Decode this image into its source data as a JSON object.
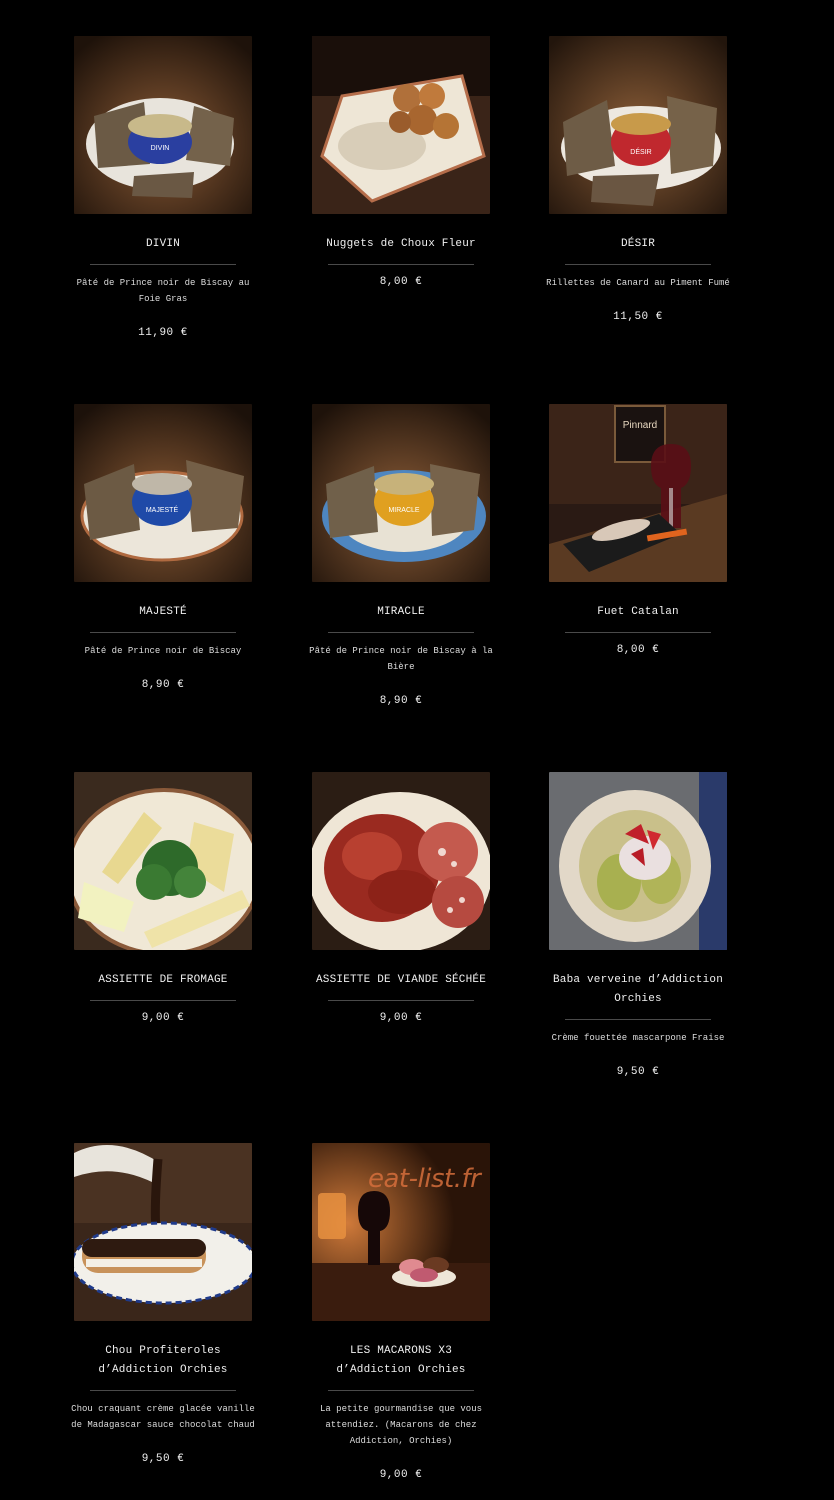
{
  "items": [
    {
      "name": "DIVIN",
      "desc": "Pâté de Prince noir de Biscay au Foie Gras",
      "price": "11,90 €",
      "tin_label": "DIVIN",
      "tin_color": "#2a3fa0"
    },
    {
      "name": "Nuggets de Choux Fleur",
      "desc": "",
      "price": "8,00 €"
    },
    {
      "name": "DÉSIR",
      "desc": "Rillettes de Canard au Piment Fumé",
      "price": "11,50 €",
      "tin_label": "DÉSIR",
      "tin_color": "#c0282e"
    },
    {
      "name": "MAJESTÉ",
      "desc": "Pâté de Prince noir de Biscay",
      "price": "8,90 €",
      "tin_label": "MAJESTÉ",
      "tin_color": "#1f4aa8"
    },
    {
      "name": "MIRACLE",
      "desc": "Pâté de Prince noir de Biscay à la Bière",
      "price": "8,90 €",
      "tin_label": "MIRACLE",
      "tin_color": "#e0a020"
    },
    {
      "name": "Fuet Catalan",
      "desc": "",
      "price": "8,00 €",
      "poster_text": "Pinnard"
    },
    {
      "name": "ASSIETTE DE FROMAGE",
      "desc": "",
      "price": "9,00 €"
    },
    {
      "name": "ASSIETTE DE VIANDE SÉCHÉE",
      "desc": "",
      "price": "9,00 €"
    },
    {
      "name": "Baba verveine d’Addiction Orchies",
      "desc": "Crème fouettée mascarpone Fraise",
      "price": "9,50 €"
    },
    {
      "name": "Chou Profiteroles d’Addiction Orchies",
      "desc": "Chou craquant crème glacée vanille de Madagascar sauce chocolat chaud",
      "price": "9,50 €"
    },
    {
      "name": "LES MACARONS X3 d’Addiction Orchies",
      "desc": "La petite gourmandise que vous attendiez. (Macarons de chez Addiction, Orchies)",
      "price": "9,00 €"
    }
  ],
  "watermark": "eat-list.fr",
  "colors": {
    "background": "#000000",
    "text": "#f0f0f0",
    "rule": "#4a4a4a"
  }
}
